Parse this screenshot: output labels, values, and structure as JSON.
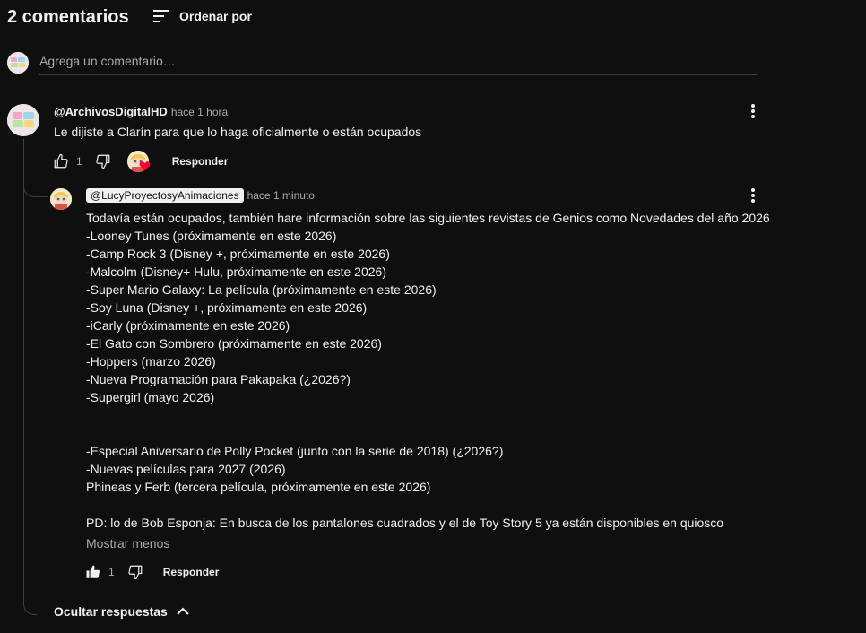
{
  "header": {
    "count_label": "2 comentarios",
    "sort_label": "Ordenar por"
  },
  "add_comment": {
    "placeholder": "Agrega un comentario…"
  },
  "comment": {
    "author": "@ArchivosDigitalHD",
    "time": "hace 1 hora",
    "text": "Le dijiste a Clarín para que lo haga oficialmente o están ocupados",
    "likes": "1",
    "reply_label": "Responder"
  },
  "reply": {
    "author": "@LucyProyectosyAnimaciones",
    "time": "hace 1 minuto",
    "lines": [
      "Todavía están ocupados, también hare información sobre las siguientes revistas de Genios como Novedades del año 2026",
      "-Looney Tunes (próximamente en este 2026)",
      "-Camp Rock 3 (Disney +, próximamente en este 2026)",
      "-Malcolm (Disney+ Hulu, próximamente en este 2026)",
      "-Super Mario Galaxy: La película (próximamente en este 2026)",
      "-Soy Luna (Disney +, próximamente en este 2026)",
      "-iCarly (próximamente en este 2026)",
      "-El Gato con Sombrero (próximamente en este 2026)",
      "-Hoppers (marzo 2026)",
      "-Nueva Programación para Pakapaka (¿2026?)",
      "-Supergirl (mayo 2026)",
      "",
      "",
      "-Especial Aniversario de Polly Pocket (junto con la serie de 2018) (¿2026?)",
      "-Nuevas películas para 2027 (2026)",
      "Phineas y Ferb (tercera película, próximamente en este 2026)",
      "",
      "PD: lo de Bob Esponja: En busca de los pantalones cuadrados y el de Toy Story 5 ya están disponibles en quiosco"
    ],
    "show_less": "Mostrar menos",
    "likes": "1",
    "reply_label": "Responder"
  },
  "hide_replies_label": "Ocultar respuestas",
  "colors": {
    "background": "#0f0f0f",
    "text": "#f1f1f1",
    "secondary_text": "#aaaaaa",
    "heart": "#ff0033"
  },
  "icons": {
    "sort": "sort-icon",
    "like": "thumb-up-icon",
    "like_filled": "thumb-up-filled-icon",
    "dislike": "thumb-down-icon",
    "menu": "more-vert-icon",
    "chevron": "chevron-up-icon",
    "heart": "creator-heart-icon"
  }
}
